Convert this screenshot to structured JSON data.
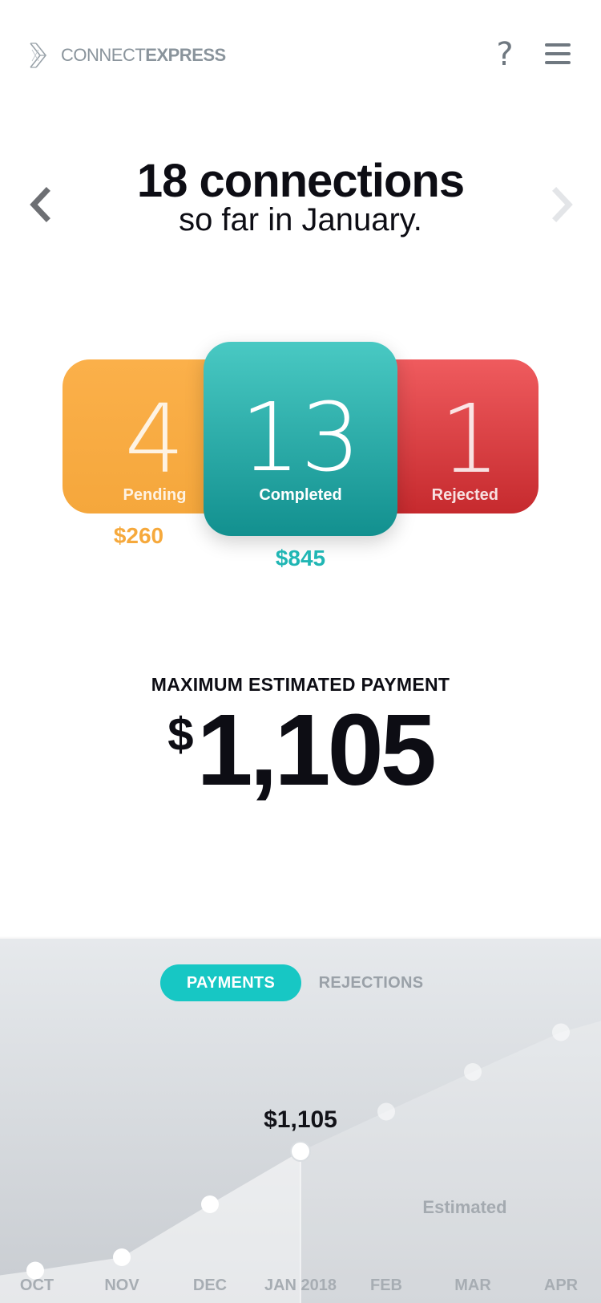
{
  "header": {
    "brand_light": "CONNECT",
    "brand_bold": "EXPRESS",
    "help_label": "?",
    "icons": {
      "logo": "connectexpress-logo-icon",
      "help": "question-mark-icon",
      "menu": "hamburger-menu-icon"
    }
  },
  "summary": {
    "headline": "18 connections",
    "subline": "so far in January."
  },
  "cards": {
    "pending": {
      "count": "4",
      "label": "Pending",
      "amount": "$260",
      "color": "#f7a83d"
    },
    "completed": {
      "count": "13",
      "label": "Completed",
      "amount": "$845",
      "color": "#1aa9a6"
    },
    "rejected": {
      "count": "1",
      "label": "Rejected",
      "color": "#d83a3e"
    }
  },
  "max_payment": {
    "label": "MAXIMUM ESTIMATED PAYMENT",
    "currency": "$",
    "value": "1,105"
  },
  "tabs": {
    "payments": "PAYMENTS",
    "rejections": "REJECTIONS",
    "active": "payments",
    "active_color": "#17c7c4"
  },
  "chart_data": {
    "type": "line",
    "categories": [
      "OCT",
      "NOV",
      "DEC",
      "JAN 2018",
      "FEB",
      "MAR",
      "APR"
    ],
    "series": [
      {
        "values": [
          null,
          null,
          null,
          1105,
          null,
          null,
          null
        ]
      }
    ],
    "highlight": {
      "category": "JAN 2018",
      "label": "$1,105"
    },
    "estimated_label": "Estimated",
    "estimated_from": "FEB",
    "trend_levels": [
      0.05,
      0.1,
      0.3,
      0.5,
      0.65,
      0.8,
      0.95
    ],
    "grid": false,
    "legend": "none"
  }
}
